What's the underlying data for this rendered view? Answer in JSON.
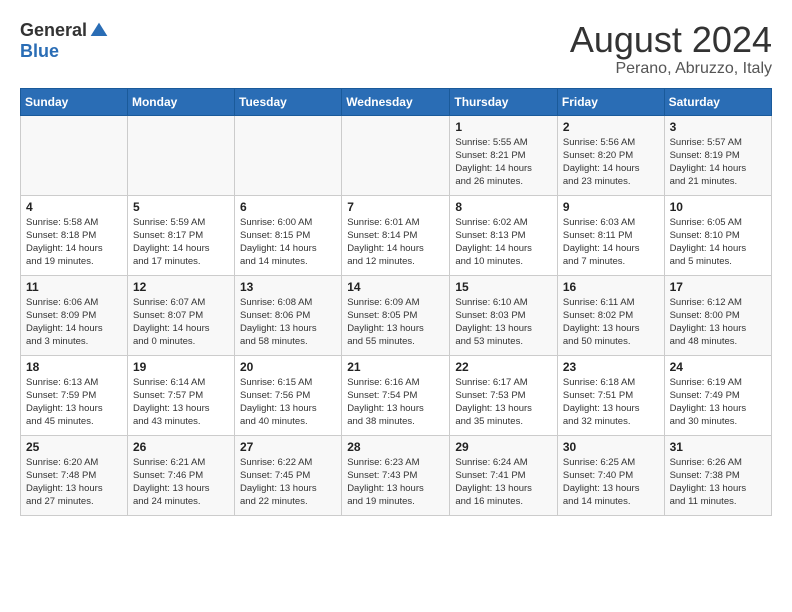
{
  "logo": {
    "general": "General",
    "blue": "Blue"
  },
  "title": {
    "month_year": "August 2024",
    "location": "Perano, Abruzzo, Italy"
  },
  "days_of_week": [
    "Sunday",
    "Monday",
    "Tuesday",
    "Wednesday",
    "Thursday",
    "Friday",
    "Saturday"
  ],
  "weeks": [
    [
      {
        "day": "",
        "info": ""
      },
      {
        "day": "",
        "info": ""
      },
      {
        "day": "",
        "info": ""
      },
      {
        "day": "",
        "info": ""
      },
      {
        "day": "1",
        "info": "Sunrise: 5:55 AM\nSunset: 8:21 PM\nDaylight: 14 hours\nand 26 minutes."
      },
      {
        "day": "2",
        "info": "Sunrise: 5:56 AM\nSunset: 8:20 PM\nDaylight: 14 hours\nand 23 minutes."
      },
      {
        "day": "3",
        "info": "Sunrise: 5:57 AM\nSunset: 8:19 PM\nDaylight: 14 hours\nand 21 minutes."
      }
    ],
    [
      {
        "day": "4",
        "info": "Sunrise: 5:58 AM\nSunset: 8:18 PM\nDaylight: 14 hours\nand 19 minutes."
      },
      {
        "day": "5",
        "info": "Sunrise: 5:59 AM\nSunset: 8:17 PM\nDaylight: 14 hours\nand 17 minutes."
      },
      {
        "day": "6",
        "info": "Sunrise: 6:00 AM\nSunset: 8:15 PM\nDaylight: 14 hours\nand 14 minutes."
      },
      {
        "day": "7",
        "info": "Sunrise: 6:01 AM\nSunset: 8:14 PM\nDaylight: 14 hours\nand 12 minutes."
      },
      {
        "day": "8",
        "info": "Sunrise: 6:02 AM\nSunset: 8:13 PM\nDaylight: 14 hours\nand 10 minutes."
      },
      {
        "day": "9",
        "info": "Sunrise: 6:03 AM\nSunset: 8:11 PM\nDaylight: 14 hours\nand 7 minutes."
      },
      {
        "day": "10",
        "info": "Sunrise: 6:05 AM\nSunset: 8:10 PM\nDaylight: 14 hours\nand 5 minutes."
      }
    ],
    [
      {
        "day": "11",
        "info": "Sunrise: 6:06 AM\nSunset: 8:09 PM\nDaylight: 14 hours\nand 3 minutes."
      },
      {
        "day": "12",
        "info": "Sunrise: 6:07 AM\nSunset: 8:07 PM\nDaylight: 14 hours\nand 0 minutes."
      },
      {
        "day": "13",
        "info": "Sunrise: 6:08 AM\nSunset: 8:06 PM\nDaylight: 13 hours\nand 58 minutes."
      },
      {
        "day": "14",
        "info": "Sunrise: 6:09 AM\nSunset: 8:05 PM\nDaylight: 13 hours\nand 55 minutes."
      },
      {
        "day": "15",
        "info": "Sunrise: 6:10 AM\nSunset: 8:03 PM\nDaylight: 13 hours\nand 53 minutes."
      },
      {
        "day": "16",
        "info": "Sunrise: 6:11 AM\nSunset: 8:02 PM\nDaylight: 13 hours\nand 50 minutes."
      },
      {
        "day": "17",
        "info": "Sunrise: 6:12 AM\nSunset: 8:00 PM\nDaylight: 13 hours\nand 48 minutes."
      }
    ],
    [
      {
        "day": "18",
        "info": "Sunrise: 6:13 AM\nSunset: 7:59 PM\nDaylight: 13 hours\nand 45 minutes."
      },
      {
        "day": "19",
        "info": "Sunrise: 6:14 AM\nSunset: 7:57 PM\nDaylight: 13 hours\nand 43 minutes."
      },
      {
        "day": "20",
        "info": "Sunrise: 6:15 AM\nSunset: 7:56 PM\nDaylight: 13 hours\nand 40 minutes."
      },
      {
        "day": "21",
        "info": "Sunrise: 6:16 AM\nSunset: 7:54 PM\nDaylight: 13 hours\nand 38 minutes."
      },
      {
        "day": "22",
        "info": "Sunrise: 6:17 AM\nSunset: 7:53 PM\nDaylight: 13 hours\nand 35 minutes."
      },
      {
        "day": "23",
        "info": "Sunrise: 6:18 AM\nSunset: 7:51 PM\nDaylight: 13 hours\nand 32 minutes."
      },
      {
        "day": "24",
        "info": "Sunrise: 6:19 AM\nSunset: 7:49 PM\nDaylight: 13 hours\nand 30 minutes."
      }
    ],
    [
      {
        "day": "25",
        "info": "Sunrise: 6:20 AM\nSunset: 7:48 PM\nDaylight: 13 hours\nand 27 minutes."
      },
      {
        "day": "26",
        "info": "Sunrise: 6:21 AM\nSunset: 7:46 PM\nDaylight: 13 hours\nand 24 minutes."
      },
      {
        "day": "27",
        "info": "Sunrise: 6:22 AM\nSunset: 7:45 PM\nDaylight: 13 hours\nand 22 minutes."
      },
      {
        "day": "28",
        "info": "Sunrise: 6:23 AM\nSunset: 7:43 PM\nDaylight: 13 hours\nand 19 minutes."
      },
      {
        "day": "29",
        "info": "Sunrise: 6:24 AM\nSunset: 7:41 PM\nDaylight: 13 hours\nand 16 minutes."
      },
      {
        "day": "30",
        "info": "Sunrise: 6:25 AM\nSunset: 7:40 PM\nDaylight: 13 hours\nand 14 minutes."
      },
      {
        "day": "31",
        "info": "Sunrise: 6:26 AM\nSunset: 7:38 PM\nDaylight: 13 hours\nand 11 minutes."
      }
    ]
  ]
}
